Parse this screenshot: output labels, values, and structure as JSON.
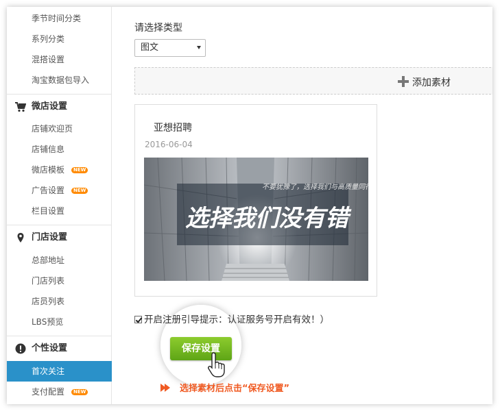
{
  "sidebar": {
    "items_top": [
      {
        "label": "季节时间分类"
      },
      {
        "label": "系列分类"
      },
      {
        "label": "混搭设置"
      },
      {
        "label": "淘宝数据包导入"
      }
    ],
    "sections": [
      {
        "title": "微店设置",
        "icon": "cart-icon",
        "items": [
          {
            "label": "店铺欢迎页"
          },
          {
            "label": "店铺信息"
          },
          {
            "label": "微店模板",
            "badge": "NEW"
          },
          {
            "label": "广告设置",
            "badge": "NEW"
          },
          {
            "label": "栏目设置"
          }
        ]
      },
      {
        "title": "门店设置",
        "icon": "location-pin-icon",
        "items": [
          {
            "label": "总部地址"
          },
          {
            "label": "门店列表"
          },
          {
            "label": "店员列表"
          },
          {
            "label": "LBS预览"
          }
        ]
      },
      {
        "title": "个性设置",
        "icon": "exclamation-circle-icon",
        "items": [
          {
            "label": "首次关注",
            "active": true
          },
          {
            "label": "支付配置",
            "badge": "NEW"
          }
        ]
      }
    ]
  },
  "main": {
    "type_label": "请选择类型",
    "type_select": {
      "value": "图文"
    },
    "add_material": "添加素材",
    "card": {
      "title": "亚想招聘",
      "date": "2016-06-04",
      "cover_text_small": "不要犹豫了，选择我们与高质量同行",
      "cover_text_big": "选择我们没有错"
    },
    "notice": "开启注册引导提示：认证服务号开启有效！）",
    "save_button": "保存设置",
    "hint": "选择素材后点击“保存设置”",
    "colors": {
      "active": "#2a91c9",
      "save_green": "#6bb51f",
      "hint": "#f05a22",
      "badge": "#ff8a00"
    }
  }
}
